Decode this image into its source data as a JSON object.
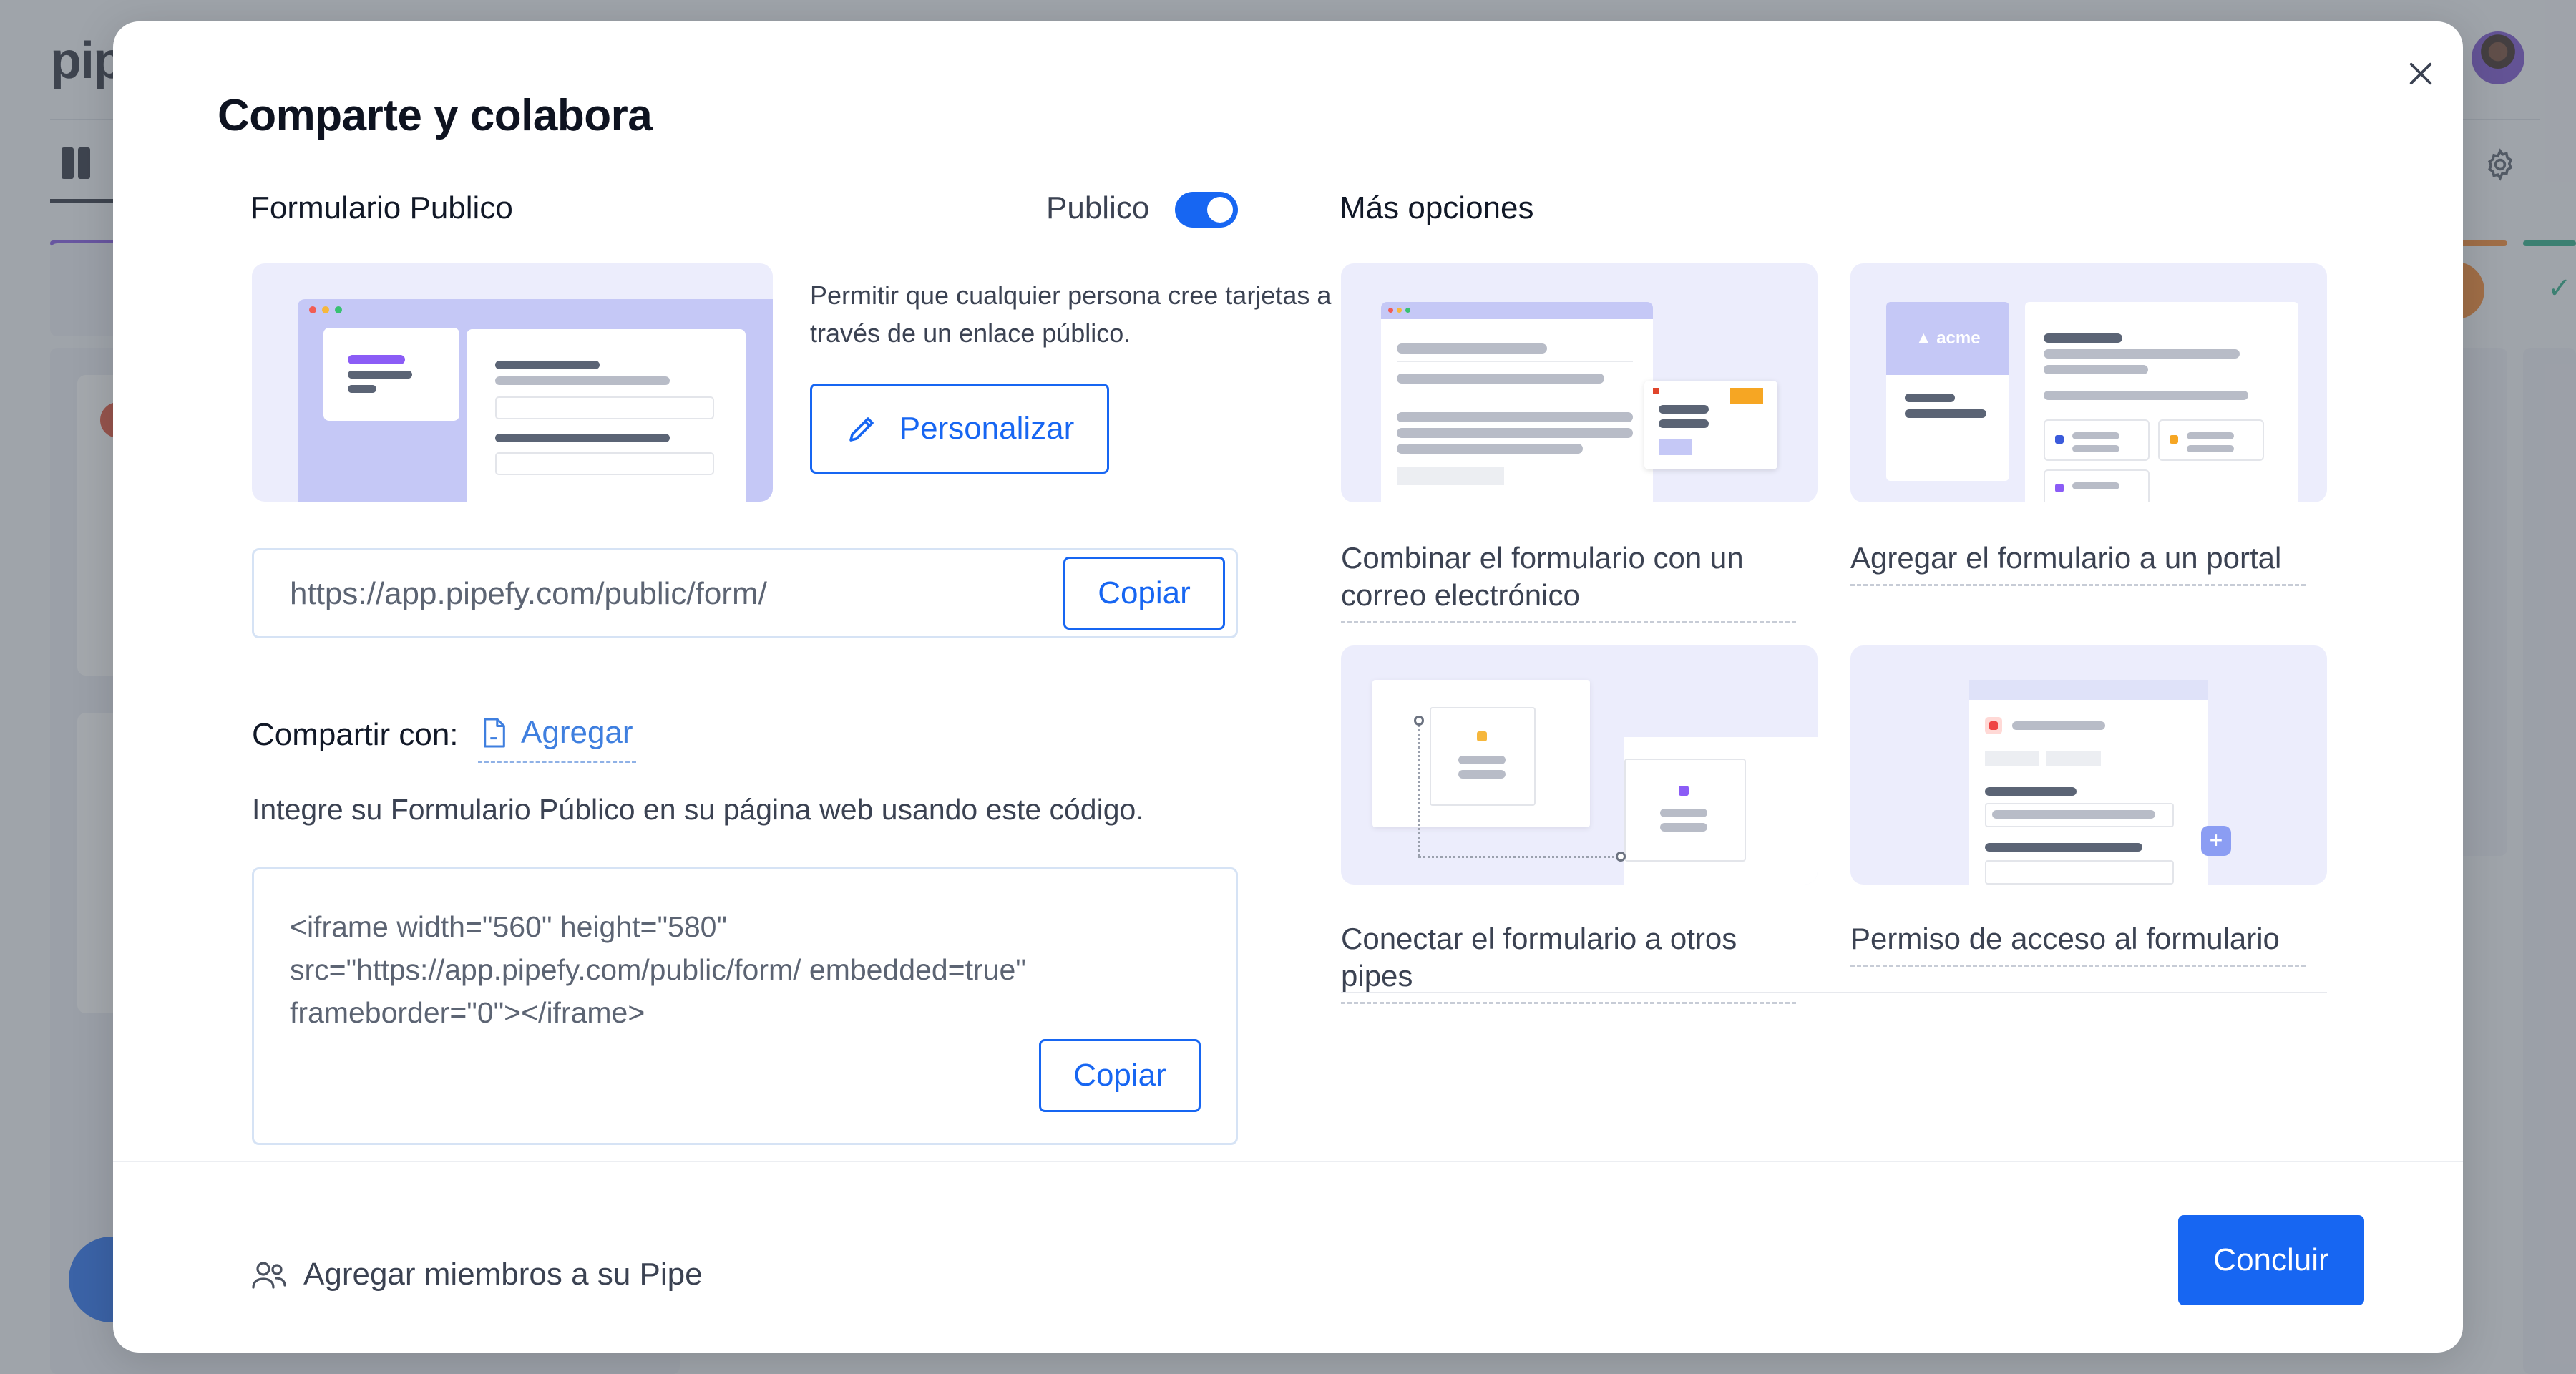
{
  "background": {
    "logo": "pip"
  },
  "modal": {
    "title": "Comparte y colabora",
    "public_form": {
      "label": "Formulario Publico",
      "toggle_label": "Publico",
      "toggle_on": true,
      "description": "Permitir que cualquier persona cree tarjetas a través de un enlace público.",
      "customize_label": "Personalizar",
      "url": "https://app.pipefy.com/public/form/",
      "copy_label": "Copiar"
    },
    "share": {
      "label": "Compartir con:",
      "add_label": "Agregar",
      "embed_description": "Integre su Formulario Público en su página web usando este código.",
      "embed_code": "<iframe width=\"560\" height=\"580\" src=\"https://app.pipefy.com/public/form/ embedded=true\" frameborder=\"0\"></iframe>",
      "copy_label": "Copiar"
    },
    "more_options": {
      "label": "Más opciones",
      "options": [
        {
          "label": "Combinar el formulario con un correo electrónico"
        },
        {
          "label": "Agregar el formulario a un portal",
          "portal_brand": "acme"
        },
        {
          "label": "Conectar el formulario a otros pipes"
        },
        {
          "label": "Permiso de acceso al formulario"
        }
      ]
    },
    "footer": {
      "members_label": "Agregar miembros a su Pipe",
      "done_label": "Concluir"
    }
  },
  "colors": {
    "accent": "#1766f2",
    "illustration_bg": "#ecedfc",
    "text": "#3b4252"
  }
}
